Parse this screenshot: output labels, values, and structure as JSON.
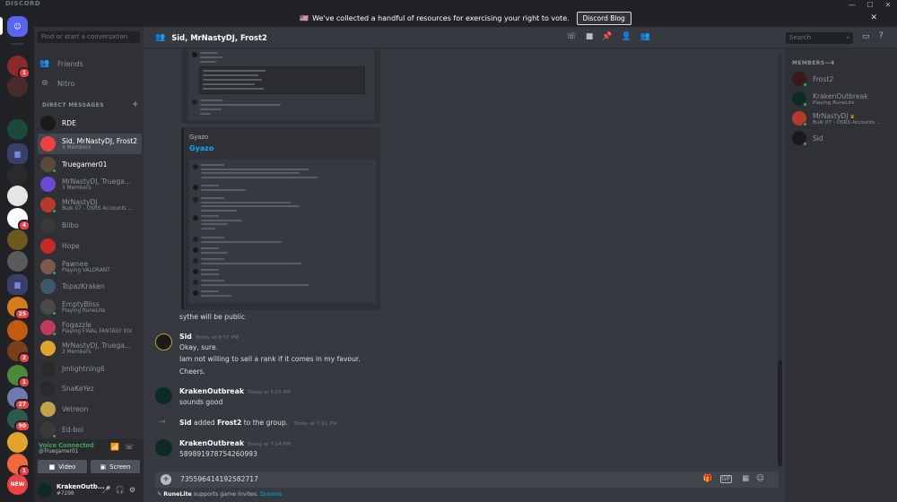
{
  "app": {
    "brand": "DISCORD",
    "window_controls": [
      "—",
      "☐",
      "✕"
    ]
  },
  "notice": {
    "flag": "🇺🇸",
    "text": "We've collected a handful of resources for exercising your right to vote.",
    "button": "Discord Blog",
    "close": "✕"
  },
  "servers": [
    {
      "label": "",
      "badge": "",
      "color": "#5865f2",
      "kind": "home"
    },
    {
      "label": "",
      "badge": "1",
      "color": "#8b2a2a"
    },
    {
      "label": "",
      "badge": "",
      "color": "#4a2b2b"
    },
    {
      "label": "",
      "badge": "",
      "color": "#222"
    },
    {
      "label": "",
      "badge": "",
      "color": "#1c4a3a"
    },
    {
      "label": "",
      "badge": "",
      "color": "#3a3f69",
      "kind": "folder"
    },
    {
      "label": "",
      "badge": "",
      "color": "#2a2a2a"
    },
    {
      "label": "",
      "badge": "",
      "color": "#e5e5e5"
    },
    {
      "label": "",
      "badge": "4",
      "color": "#ffffff"
    },
    {
      "label": "",
      "badge": "",
      "color": "#6b5a1e"
    },
    {
      "label": "",
      "badge": "",
      "color": "#5a5a5a"
    },
    {
      "label": "",
      "badge": "",
      "color": "#3a3f69",
      "kind": "folder"
    },
    {
      "label": "",
      "badge": "25",
      "color": "#d67b1a"
    },
    {
      "label": "",
      "badge": "",
      "color": "#c25a12"
    },
    {
      "label": "",
      "badge": "2",
      "color": "#7a3e1a"
    },
    {
      "label": "",
      "badge": "1",
      "color": "#4c8a3a"
    },
    {
      "label": "",
      "badge": "27",
      "color": "#6e7ab0"
    },
    {
      "label": "",
      "badge": "90",
      "color": "#2a5a4a"
    },
    {
      "label": "",
      "badge": "",
      "color": "#e0a52a"
    },
    {
      "label": "",
      "badge": "1",
      "color": "#f26a3a"
    },
    {
      "label": "NEW",
      "badge": "",
      "color": "#ed4245",
      "kind": "new"
    }
  ],
  "sidebar": {
    "search_placeholder": "Find or start a conversation",
    "nav": [
      {
        "label": "Friends",
        "icon": "👥"
      },
      {
        "label": "Nitro",
        "icon": "⊛"
      }
    ],
    "dm_header": "DIRECT MESSAGES",
    "dms": [
      {
        "name": "RDE",
        "sub": "",
        "color": "#1a1a1a",
        "status": false,
        "bright": true
      },
      {
        "name": "Sid, MrNastyDJ, Frost2",
        "sub": "4 Members",
        "color": "#ed4245",
        "status": false,
        "active": true
      },
      {
        "name": "Truegamer01",
        "sub": "",
        "color": "#5a4a3a",
        "status": true,
        "bright": true
      },
      {
        "name": "MrNastyDJ, Truega...",
        "sub": "3 Members",
        "color": "#6b4ad6",
        "status": false
      },
      {
        "name": "MrNastyDJ",
        "sub": "Bulk 07 - OSRS Accounts ...",
        "color": "#b53a2a",
        "status": true
      },
      {
        "name": "Bilbo",
        "sub": "",
        "color": "#3a3a3a",
        "status": false
      },
      {
        "name": "Hope",
        "sub": "",
        "color": "#c22a2a",
        "status": false
      },
      {
        "name": "Pawnee",
        "sub": "Playing VALORANT",
        "color": "#7a5a4a",
        "status": true
      },
      {
        "name": "TopazKraken",
        "sub": "",
        "color": "#3a5a6a",
        "status": false
      },
      {
        "name": "EmptyBliss",
        "sub": "Playing RuneLite",
        "color": "#4a4a4a",
        "status": true
      },
      {
        "name": "Fogazzle",
        "sub": "Playing FINAL FANTASY XIV",
        "color": "#c23a5a",
        "status": true
      },
      {
        "name": "MrNastyDJ, Truega...",
        "sub": "3 Members",
        "color": "#e0a52a",
        "status": false
      },
      {
        "name": "Jmlightning6",
        "sub": "",
        "color": "#2a2a2a",
        "status": false
      },
      {
        "name": "SnaKeYez",
        "sub": "",
        "color": "#2a2a2a",
        "status": false
      },
      {
        "name": "Vetreon",
        "sub": "",
        "color": "#c2a24a",
        "status": false
      },
      {
        "name": "Ed-boi",
        "sub": "",
        "color": "#3a3a3a",
        "status": true
      }
    ]
  },
  "voice": {
    "title": "Voice Connected",
    "subtitle": "@Truegamer01",
    "video_button": "Video",
    "screen_button": "Screen"
  },
  "user": {
    "name": "KrakenOutb...",
    "tag": "#7298"
  },
  "channel": {
    "title": "Sid, MrNastyDJ, Frost2",
    "search_placeholder": "Search"
  },
  "embed": {
    "provider": "Gyazo",
    "title": "Gyazo"
  },
  "messages": {
    "standalone_1": "sythe will be public",
    "sid": {
      "author": "Sid",
      "time": "Today at 6:57 PM",
      "lines": [
        "Okay, sure.",
        "Iam not willing to sell a rank if it comes in my favour.",
        "Cheers."
      ]
    },
    "kraken_1": {
      "author": "KrakenOutbreak",
      "time": "Today at 6:59 PM",
      "lines": [
        "sounds good"
      ]
    },
    "system": {
      "actor": "Sid",
      "verb": "added",
      "target": "Frost2",
      "suffix": "to the group.",
      "time": "Today at 7:01 PM"
    },
    "kraken_2": {
      "author": "KrakenOutbreak",
      "time": "Today at 7:14 PM",
      "lines": [
        "5898919787542609​93"
      ]
    }
  },
  "composer": {
    "text": "735596414192582717"
  },
  "hint": {
    "prefix": "RuneLite",
    "text": " supports game invites. ",
    "dismiss": "Dismiss"
  },
  "members": {
    "header": "MEMBERS—4",
    "list": [
      {
        "name": "Frost2",
        "sub": "",
        "color": "#3a1a1a",
        "crown": false
      },
      {
        "name": "KrakenOutbreak",
        "sub": "Playing RuneLite",
        "color": "#0d2b22",
        "crown": false
      },
      {
        "name": "MrNastyDJ",
        "sub": "Bulk 07 - OSRS Accounts ...",
        "color": "#b53a2a",
        "crown": true
      },
      {
        "name": "Sid",
        "sub": "",
        "color": "#1a1a1a",
        "crown": false
      }
    ]
  }
}
